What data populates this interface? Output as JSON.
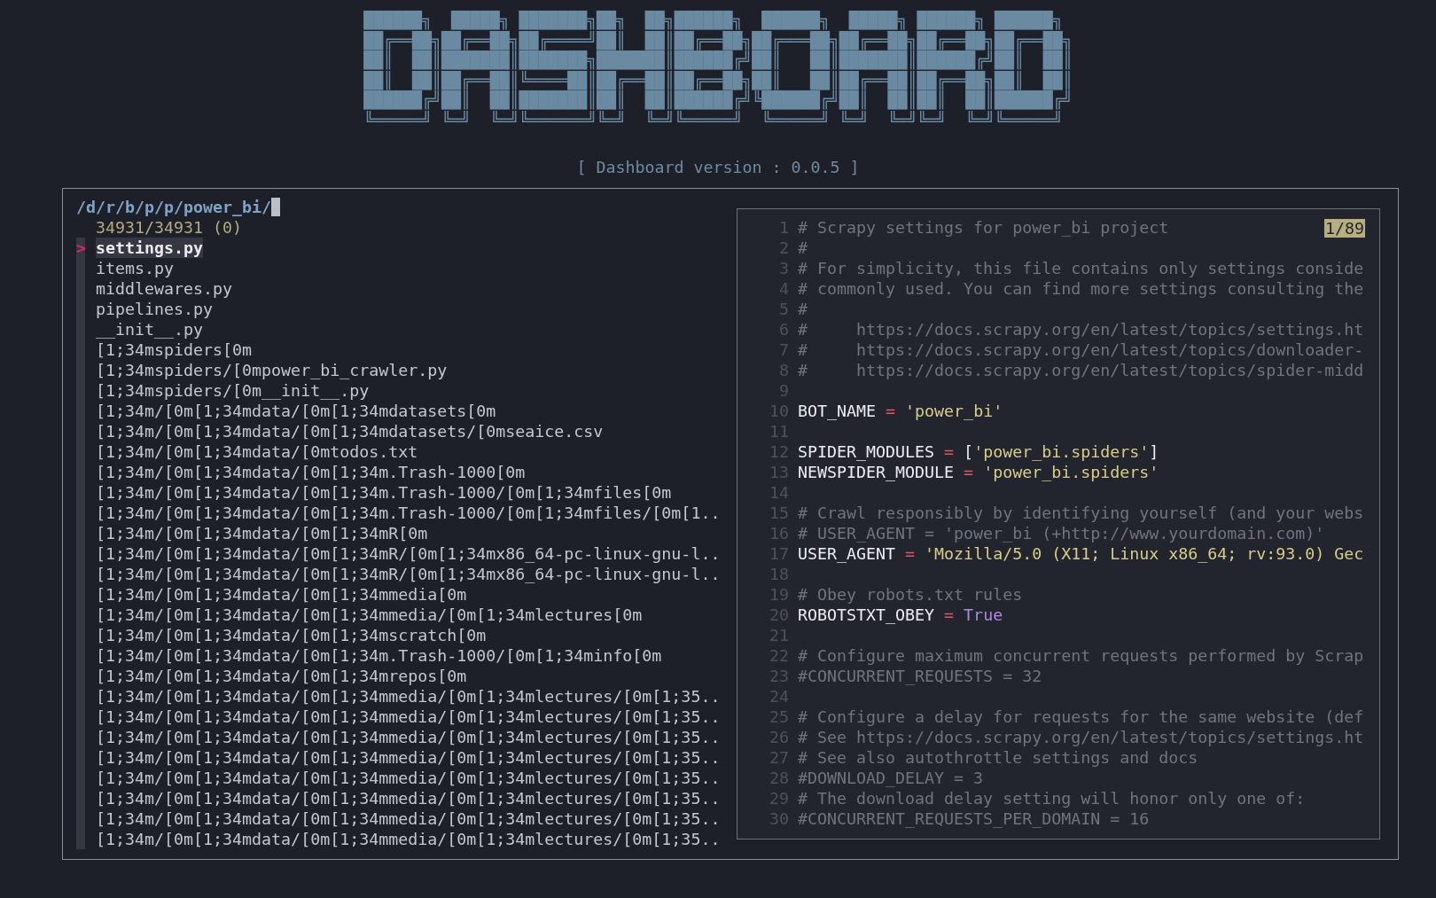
{
  "banner": {
    "lines": [
      "██████╗  █████╗ ███████╗██╗  ██╗██████╗  ██████╗  █████╗ ██████╗ ██████╗ ",
      "██╔══██╗██╔══██╗██╔════╝██║  ██║██╔══██╗██╔═══██╗██╔══██╗██╔══██╗██╔══██╗",
      "██║  ██║███████║███████╗███████║██████╔╝██║   ██║███████║██████╔╝██║  ██║",
      "██║  ██║██╔══██║╚════██║██╔══██║██╔══██╗██║   ██║██╔══██║██╔══██╗██║  ██║",
      "██████╔╝██║  ██║███████║██║  ██║██████╔╝╚██████╔╝██║  ██║██║  ██║██████╔╝",
      "╚═════╝ ╚═╝  ╚═╝╚══════╝╚═╝  ╚═╝╚═════╝  ╚═════╝ ╚═╝  ╚═╝╚═╝  ╚═╝╚═════╝ "
    ],
    "version": "[ Dashboard version : 0.0.5 ]"
  },
  "finder": {
    "prompt": "/d/r/b/p/p/power_bi/",
    "count": "34931/34931 (0)",
    "pointer": ">",
    "items": [
      {
        "text": "settings.py",
        "selected": true
      },
      {
        "text": "items.py",
        "selected": false
      },
      {
        "text": "middlewares.py",
        "selected": false
      },
      {
        "text": "pipelines.py",
        "selected": false
      },
      {
        "text": "__init__.py",
        "selected": false
      },
      {
        "text": "[1;34mspiders[0m",
        "selected": false
      },
      {
        "text": "[1;34mspiders/[0mpower_bi_crawler.py",
        "selected": false
      },
      {
        "text": "[1;34mspiders/[0m__init__.py",
        "selected": false
      },
      {
        "text": "[1;34m/[0m[1;34mdata/[0m[1;34mdatasets[0m",
        "selected": false
      },
      {
        "text": "[1;34m/[0m[1;34mdata/[0m[1;34mdatasets/[0mseaice.csv",
        "selected": false
      },
      {
        "text": "[1;34m/[0m[1;34mdata/[0mtodos.txt",
        "selected": false
      },
      {
        "text": "[1;34m/[0m[1;34mdata/[0m[1;34m.Trash-1000[0m",
        "selected": false
      },
      {
        "text": "[1;34m/[0m[1;34mdata/[0m[1;34m.Trash-1000/[0m[1;34mfiles[0m",
        "selected": false
      },
      {
        "text": "[1;34m/[0m[1;34mdata/[0m[1;34m.Trash-1000/[0m[1;34mfiles/[0m[1..",
        "selected": false
      },
      {
        "text": "[1;34m/[0m[1;34mdata/[0m[1;34mR[0m",
        "selected": false
      },
      {
        "text": "[1;34m/[0m[1;34mdata/[0m[1;34mR/[0m[1;34mx86_64-pc-linux-gnu-l..",
        "selected": false
      },
      {
        "text": "[1;34m/[0m[1;34mdata/[0m[1;34mR/[0m[1;34mx86_64-pc-linux-gnu-l..",
        "selected": false
      },
      {
        "text": "[1;34m/[0m[1;34mdata/[0m[1;34mmedia[0m",
        "selected": false
      },
      {
        "text": "[1;34m/[0m[1;34mdata/[0m[1;34mmedia/[0m[1;34mlectures[0m",
        "selected": false
      },
      {
        "text": "[1;34m/[0m[1;34mdata/[0m[1;34mscratch[0m",
        "selected": false
      },
      {
        "text": "[1;34m/[0m[1;34mdata/[0m[1;34m.Trash-1000/[0m[1;34minfo[0m",
        "selected": false
      },
      {
        "text": "[1;34m/[0m[1;34mdata/[0m[1;34mrepos[0m",
        "selected": false
      },
      {
        "text": "[1;34m/[0m[1;34mdata/[0m[1;34mmedia/[0m[1;34mlectures/[0m[1;35..",
        "selected": false
      },
      {
        "text": "[1;34m/[0m[1;34mdata/[0m[1;34mmedia/[0m[1;34mlectures/[0m[1;35..",
        "selected": false
      },
      {
        "text": "[1;34m/[0m[1;34mdata/[0m[1;34mmedia/[0m[1;34mlectures/[0m[1;35..",
        "selected": false
      },
      {
        "text": "[1;34m/[0m[1;34mdata/[0m[1;34mmedia/[0m[1;34mlectures/[0m[1;35..",
        "selected": false
      },
      {
        "text": "[1;34m/[0m[1;34mdata/[0m[1;34mmedia/[0m[1;34mlectures/[0m[1;35..",
        "selected": false
      },
      {
        "text": "[1;34m/[0m[1;34mdata/[0m[1;34mmedia/[0m[1;34mlectures/[0m[1;35..",
        "selected": false
      },
      {
        "text": "[1;34m/[0m[1;34mdata/[0m[1;34mmedia/[0m[1;34mlectures/[0m[1;35..",
        "selected": false
      },
      {
        "text": "[1;34m/[0m[1;34mdata/[0m[1;34mmedia/[0m[1;34mlectures/[0m[1;35..",
        "selected": false
      }
    ]
  },
  "preview": {
    "position": "1/89",
    "lines": [
      {
        "number": "1",
        "tokens": [
          {
            "kind": "comment",
            "text": "# Scrapy settings for power_bi project"
          }
        ]
      },
      {
        "number": "2",
        "tokens": [
          {
            "kind": "comment",
            "text": "#"
          }
        ]
      },
      {
        "number": "3",
        "tokens": [
          {
            "kind": "comment",
            "text": "# For simplicity, this file contains only settings conside"
          }
        ]
      },
      {
        "number": "4",
        "tokens": [
          {
            "kind": "comment",
            "text": "# commonly used. You can find more settings consulting the"
          }
        ]
      },
      {
        "number": "5",
        "tokens": [
          {
            "kind": "comment",
            "text": "#"
          }
        ]
      },
      {
        "number": "6",
        "tokens": [
          {
            "kind": "comment",
            "text": "#     https://docs.scrapy.org/en/latest/topics/settings.ht"
          }
        ]
      },
      {
        "number": "7",
        "tokens": [
          {
            "kind": "comment",
            "text": "#     https://docs.scrapy.org/en/latest/topics/downloader-"
          }
        ]
      },
      {
        "number": "8",
        "tokens": [
          {
            "kind": "comment",
            "text": "#     https://docs.scrapy.org/en/latest/topics/spider-midd"
          }
        ]
      },
      {
        "number": "9"
      },
      {
        "number": "10",
        "tokens": [
          {
            "kind": "ident",
            "text": "BOT_NAME "
          },
          {
            "kind": "op",
            "text": "="
          },
          {
            "kind": "string",
            "text": " 'power_bi'"
          }
        ]
      },
      {
        "number": "11"
      },
      {
        "number": "12",
        "tokens": [
          {
            "kind": "ident",
            "text": "SPIDER_MODULES "
          },
          {
            "kind": "op",
            "text": "="
          },
          {
            "kind": "ident",
            "text": " ["
          },
          {
            "kind": "string",
            "text": "'power_bi.spiders'"
          },
          {
            "kind": "ident",
            "text": "]"
          }
        ]
      },
      {
        "number": "13",
        "tokens": [
          {
            "kind": "ident",
            "text": "NEWSPIDER_MODULE "
          },
          {
            "kind": "op",
            "text": "="
          },
          {
            "kind": "string",
            "text": " 'power_bi.spiders'"
          }
        ]
      },
      {
        "number": "14"
      },
      {
        "number": "15",
        "tokens": [
          {
            "kind": "comment",
            "text": "# Crawl responsibly by identifying yourself (and your webs"
          }
        ]
      },
      {
        "number": "16",
        "tokens": [
          {
            "kind": "comment",
            "text": "# USER_AGENT = 'power_bi (+http://www.yourdomain.com)'"
          }
        ]
      },
      {
        "number": "17",
        "tokens": [
          {
            "kind": "ident",
            "text": "USER_AGENT "
          },
          {
            "kind": "op",
            "text": "="
          },
          {
            "kind": "string",
            "text": " 'Mozilla/5.0 (X11; Linux x86_64; rv:93.0) Gec"
          }
        ]
      },
      {
        "number": "18"
      },
      {
        "number": "19",
        "tokens": [
          {
            "kind": "comment",
            "text": "# Obey robots.txt rules"
          }
        ]
      },
      {
        "number": "20",
        "tokens": [
          {
            "kind": "ident",
            "text": "ROBOTSTXT_OBEY "
          },
          {
            "kind": "op",
            "text": "="
          },
          {
            "kind": "bool",
            "text": " True"
          }
        ]
      },
      {
        "number": "21"
      },
      {
        "number": "22",
        "tokens": [
          {
            "kind": "comment",
            "text": "# Configure maximum concurrent requests performed by Scrap"
          }
        ]
      },
      {
        "number": "23",
        "tokens": [
          {
            "kind": "comment",
            "text": "#CONCURRENT_REQUESTS = 32"
          }
        ]
      },
      {
        "number": "24"
      },
      {
        "number": "25",
        "tokens": [
          {
            "kind": "comment",
            "text": "# Configure a delay for requests for the same website (def"
          }
        ]
      },
      {
        "number": "26",
        "tokens": [
          {
            "kind": "comment",
            "text": "# See https://docs.scrapy.org/en/latest/topics/settings.ht"
          }
        ]
      },
      {
        "number": "27",
        "tokens": [
          {
            "kind": "comment",
            "text": "# See also autothrottle settings and docs"
          }
        ]
      },
      {
        "number": "28",
        "tokens": [
          {
            "kind": "comment",
            "text": "#DOWNLOAD_DELAY = 3"
          }
        ]
      },
      {
        "number": "29",
        "tokens": [
          {
            "kind": "comment",
            "text": "# The download delay setting will honor only one of:"
          }
        ]
      },
      {
        "number": "30",
        "tokens": [
          {
            "kind": "comment",
            "text": "#CONCURRENT_REQUESTS_PER_DOMAIN = 16"
          }
        ]
      }
    ]
  }
}
